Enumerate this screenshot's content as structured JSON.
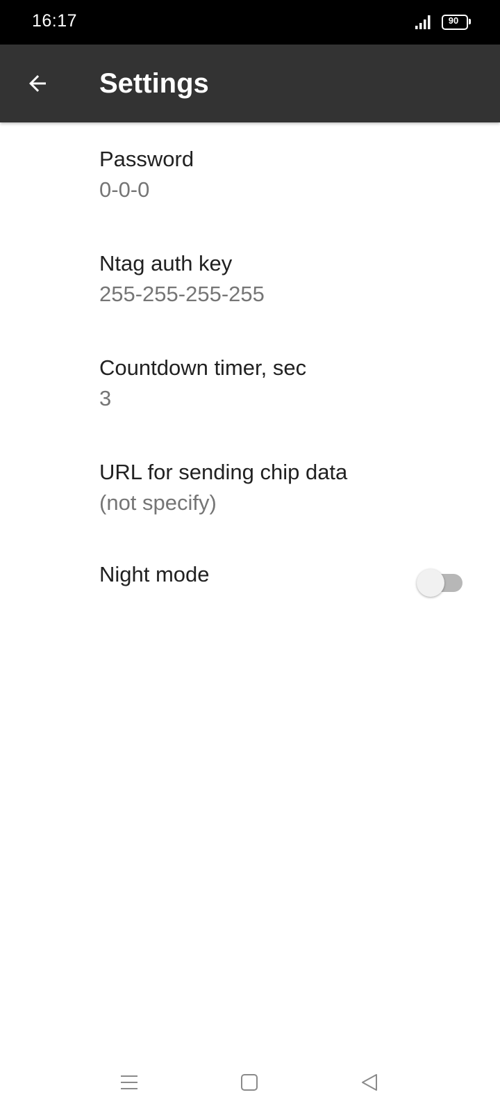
{
  "status_bar": {
    "time": "16:17",
    "battery_level": "90",
    "icons": [
      "signal-icon",
      "battery-icon"
    ]
  },
  "toolbar": {
    "title": "Settings",
    "back_icon": "arrow-left-icon"
  },
  "settings": [
    {
      "title": "Password",
      "summary": "0-0-0"
    },
    {
      "title": "Ntag auth key",
      "summary": "255-255-255-255"
    },
    {
      "title": "Countdown timer, sec",
      "summary": "3"
    },
    {
      "title": "URL for sending chip data",
      "summary": "(not specify)"
    }
  ],
  "night_mode": {
    "title": "Night mode",
    "enabled": false
  },
  "nav_bar": {
    "icons": [
      "menu-icon",
      "home-icon",
      "back-icon"
    ]
  },
  "colors": {
    "status_bar": "#000000",
    "toolbar": "#333333",
    "title_text": "#212121",
    "summary_text": "#757575"
  }
}
